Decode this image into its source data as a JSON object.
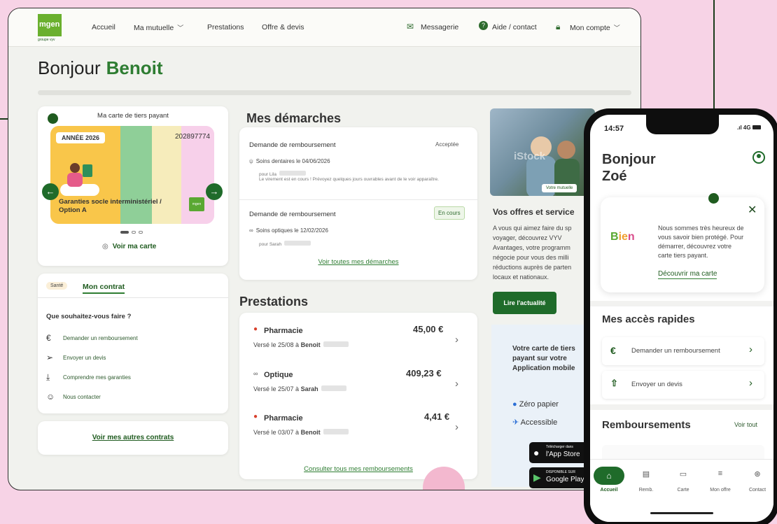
{
  "colors": {
    "brand": "#2e7d32",
    "background": "#f7d3e6"
  },
  "topnav": {
    "logo": "mgen",
    "logo_sub": "groupe vyv",
    "items": [
      "Accueil",
      "Ma mutuelle",
      "Prestations",
      "Offre & devis"
    ],
    "messagerie": "Messagerie",
    "aide": "Aide / contact",
    "compte": "Mon compte"
  },
  "greeting": {
    "prefix": "Bonjour",
    "name": "Benoit"
  },
  "tiers": {
    "title": "Ma carte de tiers payant",
    "year": "ANNÉE 2026",
    "number": "202897774",
    "guarantee": "Garanties socle interministériel / Option A",
    "mini_logo": "mgen",
    "view": "Voir ma carte"
  },
  "contract": {
    "badge": "Santé",
    "title": "Mon contrat",
    "question": "Que souhaitez-vous faire ?",
    "actions": [
      {
        "icon": "euro-icon",
        "label": "Demander un remboursement"
      },
      {
        "icon": "send-icon",
        "label": "Envoyer un devis"
      },
      {
        "icon": "download-icon",
        "label": "Comprendre mes garanties"
      },
      {
        "icon": "chat-icon",
        "label": "Nous contacter"
      }
    ]
  },
  "other_contracts": "Voir mes autres contrats",
  "demarches": {
    "title": "Mes démarches",
    "items": [
      {
        "label": "Demande de remboursement",
        "status": "Acceptée",
        "detail": "Soins dentaires le 04/06/2026",
        "for": "pour Lila",
        "note": "Le virement est en cours ! Prévoyez quelques jours ouvrables avant de le voir apparaître."
      },
      {
        "label": "Demande de remboursement",
        "status": "En cours",
        "detail": "Soins optiques le 12/02/2026",
        "for": "pour Sarah"
      }
    ],
    "link": "Voir toutes mes démarches"
  },
  "prestations": {
    "title": "Prestations",
    "items": [
      {
        "name": "Pharmacie",
        "amount": "45,00 €",
        "date": "Versé le 25/08 à",
        "who": "Benoit"
      },
      {
        "name": "Optique",
        "amount": "409,23 €",
        "date": "Versé le 25/07 à",
        "who": "Sarah"
      },
      {
        "name": "Pharmacie",
        "amount": "4,41 €",
        "date": "Versé le 03/07 à",
        "who": "Benoit"
      }
    ],
    "link": "Consulter tous mes remboursements"
  },
  "offers": {
    "photo_watermark": "iStock",
    "photo_tag": "Votre mutuelle",
    "title": "Vos offres et service",
    "lines": [
      "A vous qui aimez faire du sp",
      "voyager, découvrez VYV",
      "Avantages, votre programm",
      "négocie pour vous des milli",
      "réductions auprès de parten",
      "locaux et nationaux."
    ],
    "button": "Lire l'actualité",
    "app_lines": [
      "Votre carte de tiers",
      "payant sur votre",
      "Application mobile"
    ],
    "features": [
      "Zéro papier",
      "Accessible"
    ],
    "store1_small": "Télécharger dans",
    "store1": "l'App Store",
    "store2_small": "DISPONIBLE SUR",
    "store2": "Google Play"
  },
  "phone": {
    "time": "14:57",
    "network": "4G",
    "greeting": [
      "Bonjour",
      "Zoé"
    ],
    "notif_text": [
      "Nous sommes très heureux de",
      "vous savoir bien protégé. Pour",
      "démarrer, découvrez votre",
      "carte tiers payant."
    ],
    "notif_link": "Découvrir ma carte",
    "quick_title": "Mes accès rapides",
    "quick": [
      "Demander un remboursement",
      "Envoyer un devis"
    ],
    "remb_title": "Remboursements",
    "see_all": "Voir tout",
    "tabs": [
      "Accueil",
      "Remb.",
      "Carte",
      "Mon offre",
      "Contact"
    ]
  }
}
